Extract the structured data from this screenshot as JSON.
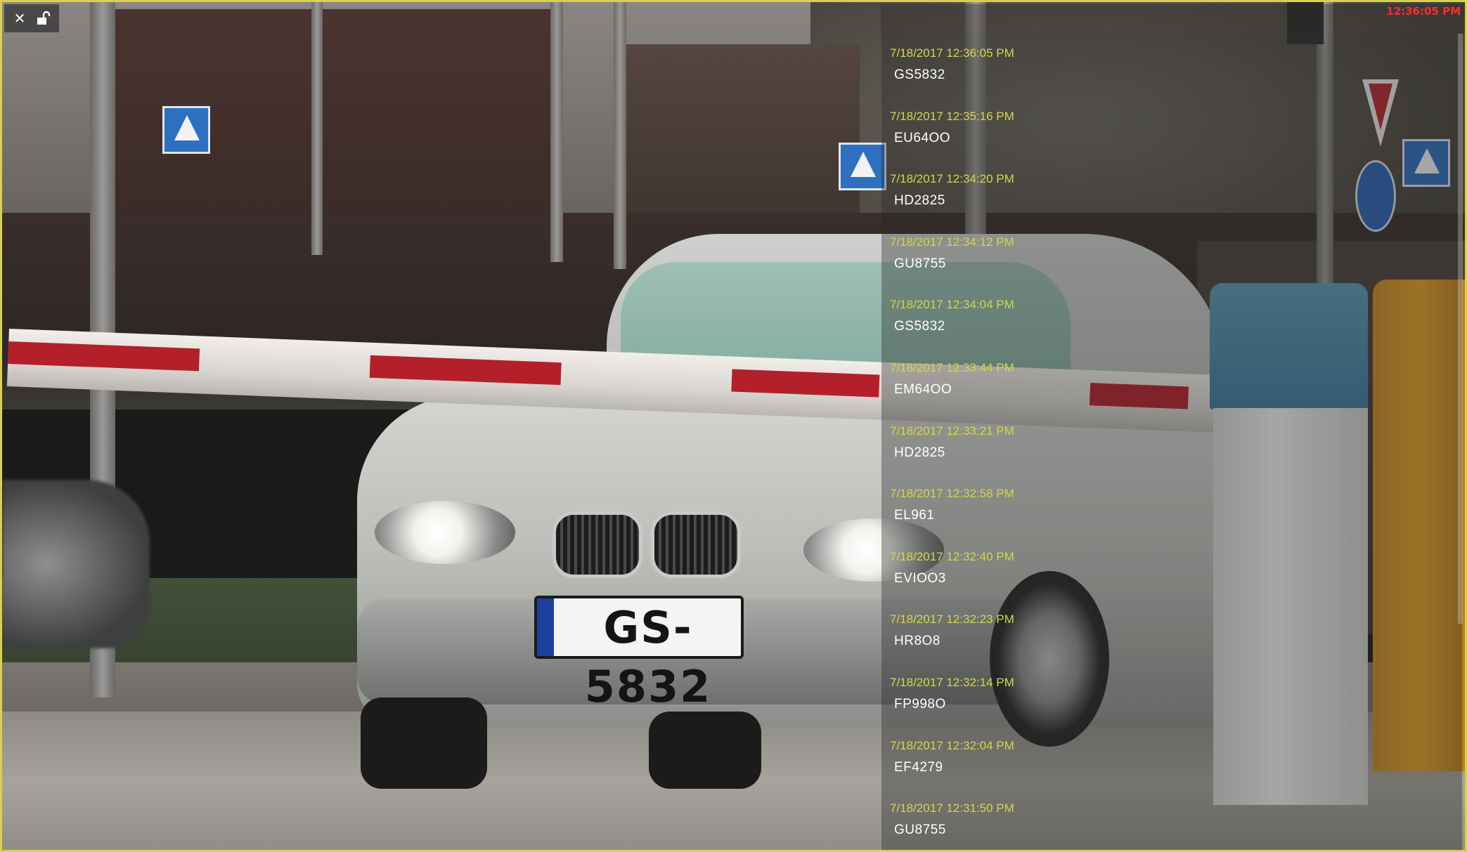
{
  "window": {
    "timestamp": "12:36:05 PM",
    "border_color": "#d8d24a"
  },
  "toolbar": {
    "close_icon": "close-icon",
    "close_glyph": "✕",
    "lock_icon": "unlock-icon"
  },
  "scene": {
    "license_plate": "GS-5832",
    "plate_country": "LV"
  },
  "plate_log": {
    "time_color": "#d4d64a",
    "plate_color": "#ffffff",
    "entries": [
      {
        "time": "7/18/2017 12:36:05 PM",
        "plate": "GS5832"
      },
      {
        "time": "7/18/2017 12:35:16 PM",
        "plate": "EU64OO"
      },
      {
        "time": "7/18/2017 12:34:20 PM",
        "plate": "HD2825"
      },
      {
        "time": "7/18/2017 12:34:12 PM",
        "plate": "GU8755"
      },
      {
        "time": "7/18/2017 12:34:04 PM",
        "plate": "GS5832"
      },
      {
        "time": "7/18/2017 12:33:44 PM",
        "plate": "EM64OO"
      },
      {
        "time": "7/18/2017 12:33:21 PM",
        "plate": "HD2825"
      },
      {
        "time": "7/18/2017 12:32:58 PM",
        "plate": "EL961"
      },
      {
        "time": "7/18/2017 12:32:40 PM",
        "plate": "EVIOO3"
      },
      {
        "time": "7/18/2017 12:32:23 PM",
        "plate": "HR8O8"
      },
      {
        "time": "7/18/2017 12:32:14 PM",
        "plate": "FP998O"
      },
      {
        "time": "7/18/2017 12:32:04 PM",
        "plate": "EF4279"
      },
      {
        "time": "7/18/2017 12:31:50 PM",
        "plate": "GU8755"
      }
    ]
  }
}
